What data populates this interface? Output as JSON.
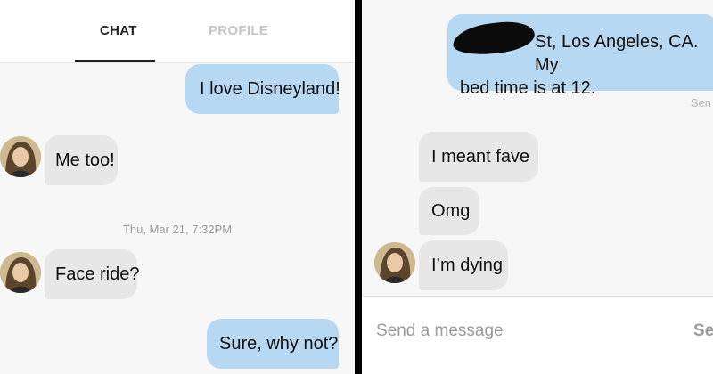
{
  "left_screen": {
    "tabs": [
      {
        "label": "CHAT"
      },
      {
        "label": "PROFILE"
      }
    ],
    "messages": [
      {
        "text": "I love Disneyland!"
      },
      {
        "text": "Me too!"
      },
      {
        "text": "Face ride?"
      },
      {
        "text": "Sure, why not?"
      }
    ],
    "timestamp": "Thu, Mar 21, 7:32PM"
  },
  "right_screen": {
    "messages": [
      {
        "line1": "St, Los Angeles, CA. My",
        "line2": "bed time is at 12."
      },
      {
        "text": "I meant fave"
      },
      {
        "text": "Omg"
      },
      {
        "text": "I’m dying"
      }
    ],
    "sent_status": "Sen",
    "compose": {
      "placeholder": "Send a message",
      "send_label": "Ser"
    }
  },
  "colors": {
    "sent_bubble": "#b7d8f3",
    "received_bubble": "#e7e7e7",
    "background": "#f7f7f7"
  }
}
